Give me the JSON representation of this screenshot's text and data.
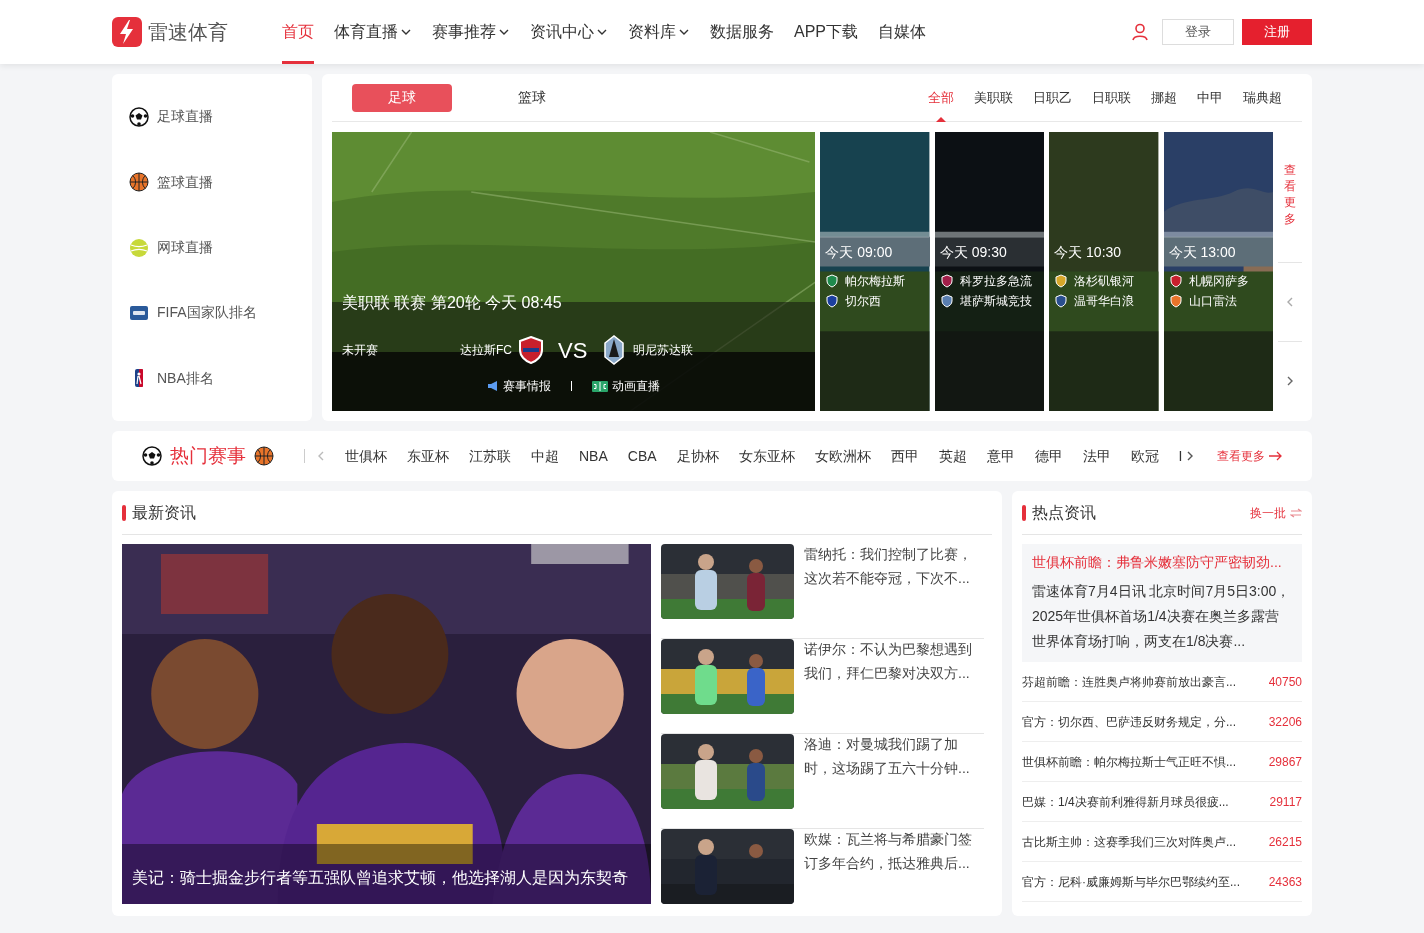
{
  "brand": {
    "name": "雷速体育"
  },
  "nav": [
    {
      "label": "首页",
      "selected": true,
      "dropdown": false
    },
    {
      "label": "体育直播",
      "selected": false,
      "dropdown": true
    },
    {
      "label": "赛事推荐",
      "selected": false,
      "dropdown": true
    },
    {
      "label": "资讯中心",
      "selected": false,
      "dropdown": true
    },
    {
      "label": "资料库",
      "selected": false,
      "dropdown": true
    },
    {
      "label": "数据服务",
      "selected": false,
      "dropdown": false
    },
    {
      "label": "APP下载",
      "selected": false,
      "dropdown": false
    },
    {
      "label": "自媒体",
      "selected": false,
      "dropdown": false
    }
  ],
  "account": {
    "login": "登录",
    "register": "注册"
  },
  "sidebar": {
    "items": [
      {
        "label": "足球直播",
        "kind": "soccer"
      },
      {
        "label": "篮球直播",
        "kind": "basketball"
      },
      {
        "label": "网球直播",
        "kind": "tennis"
      },
      {
        "label": "FIFA国家队排名",
        "kind": "fifa"
      },
      {
        "label": "NBA排名",
        "kind": "nba"
      }
    ]
  },
  "sport_tabs": [
    {
      "label": "足球",
      "selected": true
    },
    {
      "label": "篮球",
      "selected": false
    }
  ],
  "league_filters": [
    {
      "label": "全部",
      "selected": true
    },
    {
      "label": "美职联",
      "selected": false
    },
    {
      "label": "日职乙",
      "selected": false
    },
    {
      "label": "日职联",
      "selected": false
    },
    {
      "label": "挪超",
      "selected": false
    },
    {
      "label": "中甲",
      "selected": false
    },
    {
      "label": "瑞典超",
      "selected": false
    }
  ],
  "featured_match": {
    "title": "美职联 联赛 第20轮 今天 08:45",
    "status": "未开赛",
    "home": "达拉斯FC",
    "vs": "VS",
    "away": "明尼苏达联",
    "links": [
      {
        "label": "赛事情报",
        "kind": "intel"
      },
      {
        "label": "动画直播",
        "kind": "animation"
      }
    ]
  },
  "match_cards": [
    {
      "time": "今天 09:00",
      "teams": [
        {
          "name": "帕尔梅拉斯",
          "color": "#1f8a4c"
        },
        {
          "name": "切尔西",
          "color": "#1c3f9e"
        }
      ]
    },
    {
      "time": "今天 09:30",
      "teams": [
        {
          "name": "科罗拉多急流",
          "color": "#a3204a"
        },
        {
          "name": "堪萨斯城竞技",
          "color": "#5a7fb0"
        }
      ]
    },
    {
      "time": "今天 10:30",
      "teams": [
        {
          "name": "洛杉矶银河",
          "color": "#d6a72a"
        },
        {
          "name": "温哥华白浪",
          "color": "#2a4f8f"
        }
      ]
    },
    {
      "time": "今天 13:00",
      "teams": [
        {
          "name": "札幌冈萨多",
          "color": "#c8202c"
        },
        {
          "name": "山口雷法",
          "color": "#e8742a"
        }
      ]
    }
  ],
  "more_label": "查看更多",
  "hot_events": {
    "title": "热门赛事",
    "items": [
      "世俱杯",
      "东亚杯",
      "江苏联",
      "中超",
      "NBA",
      "CBA",
      "足协杯",
      "女东亚杯",
      "女欧洲杯",
      "西甲",
      "英超",
      "意甲",
      "德甲",
      "法甲",
      "欧冠",
      "I"
    ],
    "more": "查看更多"
  },
  "latest_news": {
    "title": "最新资讯",
    "main": {
      "caption": "美记：骑士掘金步行者等五强队曾追求艾顿，他选择湖人是因为东契奇"
    },
    "items": [
      {
        "text": "雷纳托：我们控制了比赛，这次若不能夺冠，下次不..."
      },
      {
        "text": "诺伊尔：不认为巴黎想遇到我们，拜仁巴黎对决双方..."
      },
      {
        "text": "洛迪：对曼城我们踢了加时，这场踢了五六十分钟..."
      },
      {
        "text": "欧媒：瓦兰将与希腊豪门签订多年合约，抵达雅典后..."
      }
    ]
  },
  "hot_news": {
    "title": "热点资讯",
    "refresh": "换一批",
    "featured": {
      "title": "世俱杯前瞻：弗鲁米嫩塞防守严密韧劲...",
      "body": "雷速体育7月4日讯 北京时间7月5日3:00，2025年世俱杯首场1/4决赛在奥兰多露营世界体育场打响，两支在1/8决赛..."
    },
    "items": [
      {
        "title": "芬超前瞻：连胜奥卢将帅赛前放出豪言...",
        "count": "40750"
      },
      {
        "title": "官方：切尔西、巴萨违反财务规定，分...",
        "count": "32206"
      },
      {
        "title": "世俱杯前瞻：帕尔梅拉斯士气正旺不惧...",
        "count": "29867"
      },
      {
        "title": "巴媒：1/4决赛前利雅得新月球员很疲...",
        "count": "29117"
      },
      {
        "title": "古比斯主帅：这赛季我们三次对阵奥卢...",
        "count": "26215"
      },
      {
        "title": "官方：尼科·威廉姆斯与毕尔巴鄂续约至...",
        "count": "24363"
      }
    ]
  }
}
